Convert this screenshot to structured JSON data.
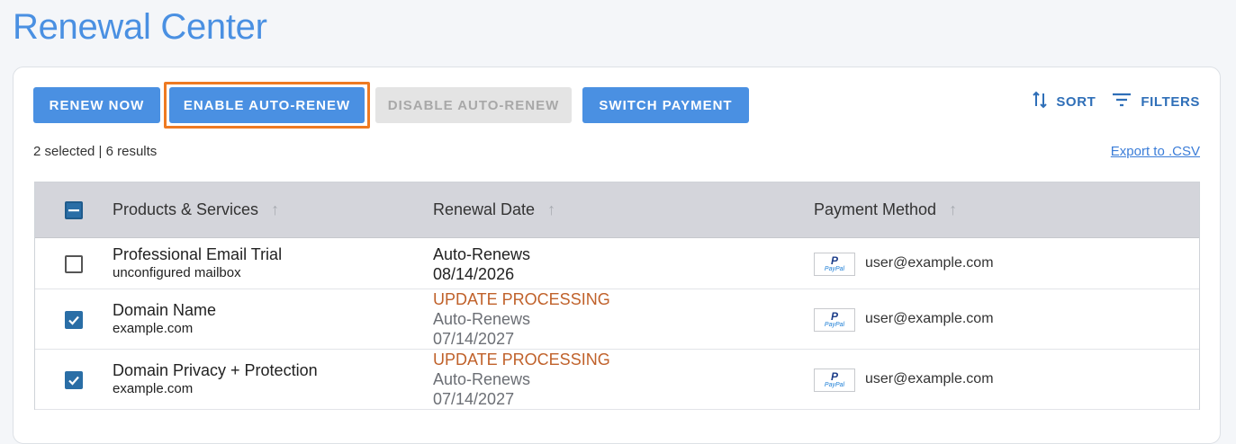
{
  "page": {
    "title": "Renewal Center"
  },
  "toolbar": {
    "renew_now": "RENEW NOW",
    "enable_auto_renew": "ENABLE AUTO-RENEW",
    "disable_auto_renew": "DISABLE AUTO-RENEW",
    "switch_payment": "SWITCH PAYMENT",
    "sort": "SORT",
    "filters": "FILTERS"
  },
  "status": {
    "summary": "2 selected | 6 results",
    "export": "Export to .CSV"
  },
  "colors": {
    "accent": "#4a90e2",
    "focus_ring": "#ee7a22",
    "processing": "#c0612a",
    "checkbox_checked": "#2a6ea6"
  },
  "table": {
    "columns": [
      "Products & Services",
      "Renewal Date",
      "Payment Method"
    ],
    "rows": [
      {
        "checked": false,
        "product": "Professional Email Trial",
        "subtitle": "unconfigured mailbox",
        "processing": "",
        "renewal_label": "Auto-Renews",
        "renewal_date": "08/14/2026",
        "payment_icon": "paypal-icon",
        "paypal_logo": "PayPal",
        "payment": "user@example.com"
      },
      {
        "checked": true,
        "product": "Domain Name",
        "subtitle": "example.com",
        "processing": "UPDATE PROCESSING",
        "renewal_label": "Auto-Renews",
        "renewal_date": "07/14/2027",
        "payment_icon": "paypal-icon",
        "paypal_logo": "PayPal",
        "payment": "user@example.com"
      },
      {
        "checked": true,
        "product": "Domain Privacy + Protection",
        "subtitle": "example.com",
        "processing": "UPDATE PROCESSING",
        "renewal_label": "Auto-Renews",
        "renewal_date": "07/14/2027",
        "payment_icon": "paypal-icon",
        "paypal_logo": "PayPal",
        "payment": "user@example.com"
      }
    ]
  }
}
